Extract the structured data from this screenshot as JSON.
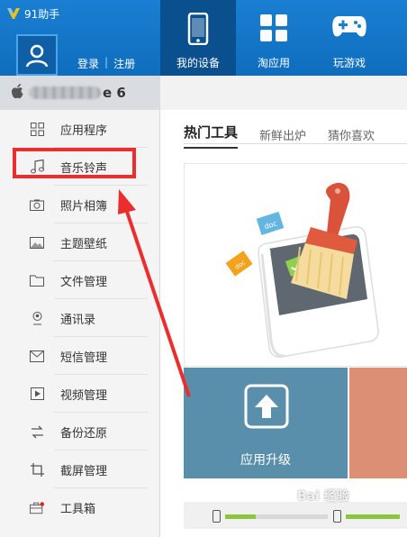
{
  "app": {
    "title": "91助手"
  },
  "header": {
    "login_label": "登录",
    "register_label": "注册",
    "tabs": [
      {
        "label": "我的设备",
        "icon": "phone-icon",
        "active": true
      },
      {
        "label": "淘应用",
        "icon": "app-grid-icon",
        "active": false
      },
      {
        "label": "玩游戏",
        "icon": "gamepad-icon",
        "active": false
      }
    ]
  },
  "device": {
    "name_suffix": "e 6"
  },
  "sidebar": {
    "items": [
      {
        "label": "应用程序",
        "icon": "app-grid-icon"
      },
      {
        "label": "音乐铃声",
        "icon": "music-note-icon",
        "highlighted": true
      },
      {
        "label": "照片相簿",
        "icon": "camera-icon"
      },
      {
        "label": "主题壁纸",
        "icon": "landscape-image-icon"
      },
      {
        "label": "文件管理",
        "icon": "folder-icon"
      },
      {
        "label": "通讯录",
        "icon": "contact-icon"
      },
      {
        "label": "短信管理",
        "icon": "envelope-icon"
      },
      {
        "label": "视频管理",
        "icon": "video-play-icon"
      },
      {
        "label": "备份还原",
        "icon": "backup-arrows-icon"
      },
      {
        "label": "截屏管理",
        "icon": "screenshot-icon"
      },
      {
        "label": "工具箱",
        "icon": "toolbox-icon",
        "badge": true
      }
    ]
  },
  "main": {
    "tabs": [
      {
        "label": "热门工具",
        "active": true
      },
      {
        "label": "新鲜出炉",
        "active": false
      },
      {
        "label": "猜你喜欢",
        "active": false
      }
    ],
    "tools": {
      "doc_badge": "doc",
      "upgrade_label": "应用升级"
    }
  },
  "watermark": {
    "text": "Bai 经验"
  },
  "colors": {
    "header_blue": "#1a7fd2",
    "active_tab": "#0a4f8e",
    "highlight_red": "#ea2e2e",
    "tile_blue": "#5a8fab",
    "tile_orange": "#dc8f74",
    "progress_green": "#8cc63f"
  }
}
